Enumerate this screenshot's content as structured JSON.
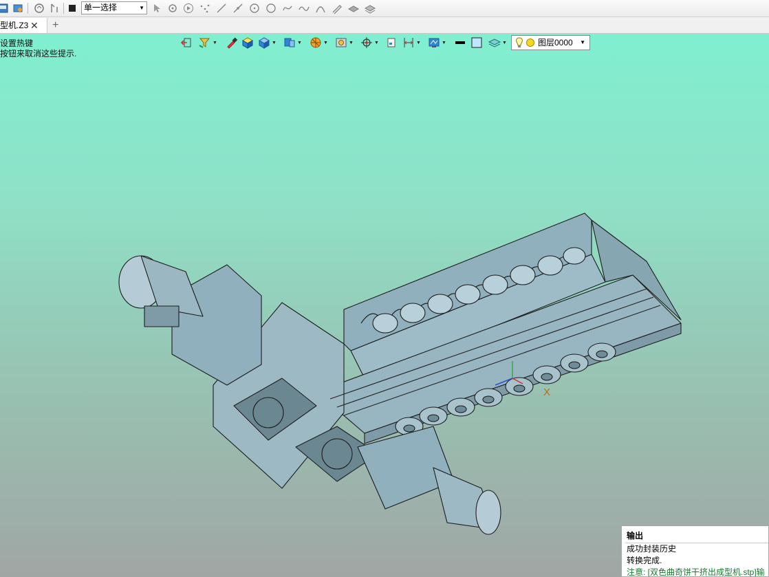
{
  "toolbar": {
    "selection_mode": "单一选择"
  },
  "tabs": [
    {
      "label": "型机.Z3"
    }
  ],
  "hints": [
    "设置热键",
    "按钮来取消这些提示."
  ],
  "view_toolbar": {
    "layer_label": "图层0000",
    "color_swatch": "#000000"
  },
  "viewport": {
    "axis_label": "X"
  },
  "output_panel": {
    "title": "输出",
    "lines": [
      "成功封装历史",
      "转换完成.",
      "注意: [双色曲奇饼干挤出成型机.stp]输"
    ]
  },
  "colors": {
    "background_top": "#7df2d2",
    "background_bottom": "#a0a6a4",
    "model_fill": "#8fb0bc",
    "note_text": "#157a2b"
  }
}
